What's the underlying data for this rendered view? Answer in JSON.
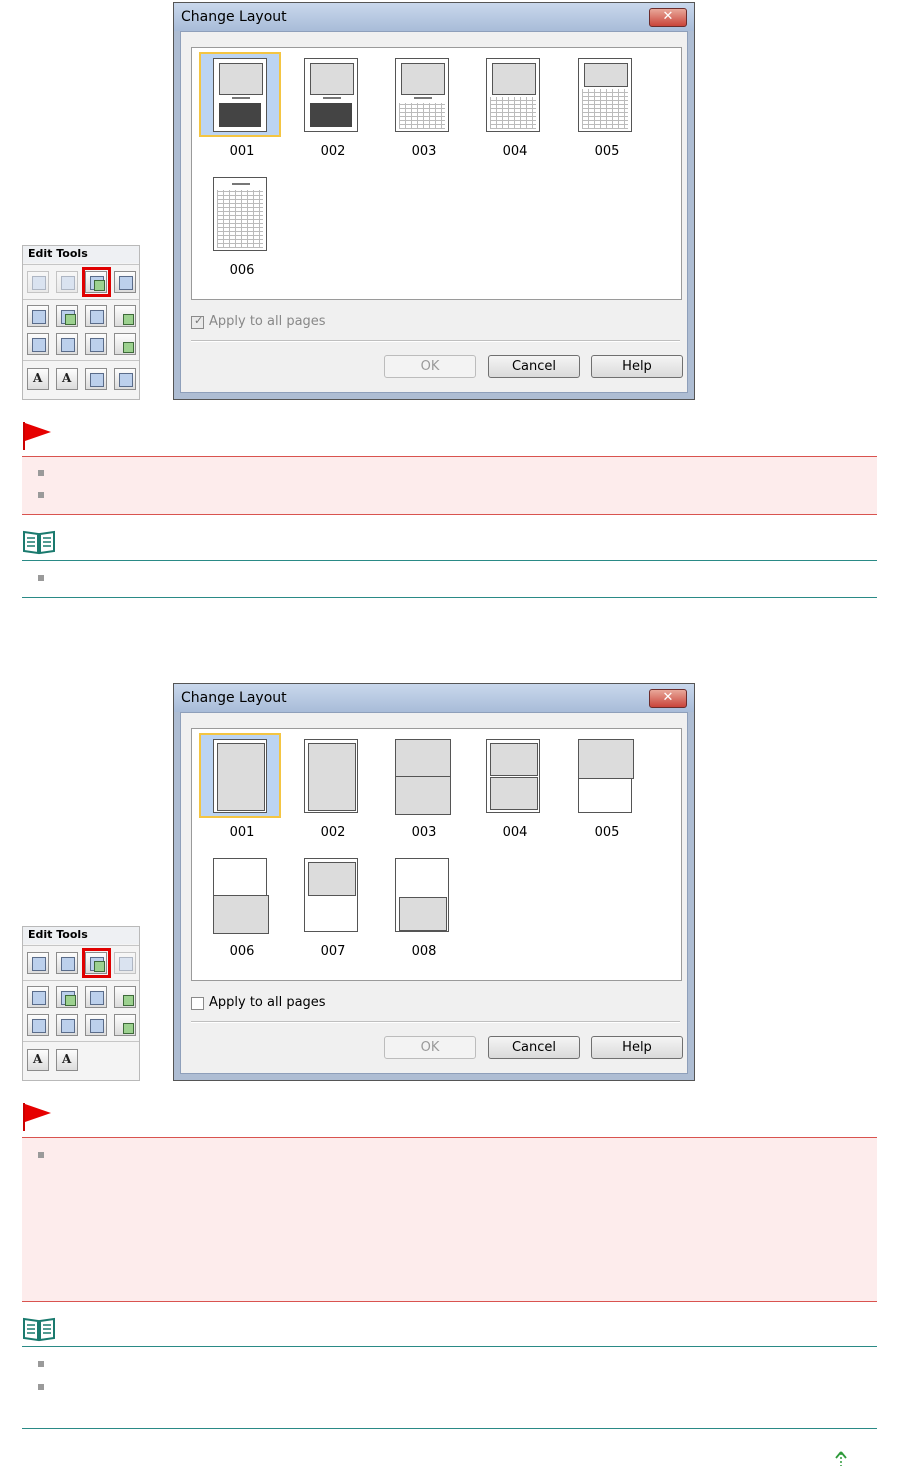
{
  "section1": {
    "palette": {
      "title_edit": "Edit",
      "title_tools": "Tools"
    },
    "dialog": {
      "title": "Change Layout",
      "close_label": "✕",
      "layouts": [
        "001",
        "002",
        "003",
        "004",
        "005",
        "006"
      ],
      "selected_layout": "001",
      "apply_label": "Apply to all pages",
      "apply_checked": true,
      "apply_enabled": false,
      "ok_label": "OK",
      "cancel_label": "Cancel",
      "help_label": "Help"
    }
  },
  "section2": {
    "palette": {
      "title_edit": "Edit",
      "title_tools": "Tools"
    },
    "dialog": {
      "title": "Change Layout",
      "close_label": "✕",
      "layouts": [
        "001",
        "002",
        "003",
        "004",
        "005",
        "006",
        "007",
        "008"
      ],
      "selected_layout": "001",
      "apply_label": "Apply to all pages",
      "apply_checked": false,
      "apply_enabled": true,
      "ok_label": "OK",
      "cancel_label": "Cancel",
      "help_label": "Help"
    }
  },
  "colors": {
    "important_bg": "#fdecec",
    "important_border": "#d9534f",
    "note_border": "#2a8a86",
    "selection_red": "#e00000",
    "selected_item_border": "#f4c542"
  },
  "icons": [
    "red-flag-icon",
    "note-book-icon",
    "page-top-arrow-icon",
    "close-icon"
  ]
}
